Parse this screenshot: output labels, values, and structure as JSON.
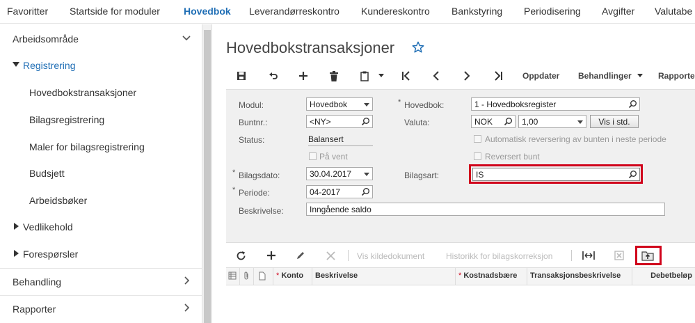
{
  "topnav": {
    "items": [
      "Favoritter",
      "Startside for moduler",
      "Hovedbok",
      "Leverandørreskontro",
      "Kundereskontro",
      "Bankstyring",
      "Periodisering",
      "Avgifter",
      "Valutabe"
    ],
    "active_index": 2
  },
  "sidebar": {
    "arbeidsomrade": "Arbeidsområde",
    "registrering": "Registrering",
    "items": [
      "Hovedbokstransaksjoner",
      "Bilagsregistrering",
      "Maler for bilagsregistrering",
      "Budsjett",
      "Arbeidsbøker"
    ],
    "vedlikehold": "Vedlikehold",
    "foresporsler": "Forespørsler",
    "behandling": "Behandling",
    "rapporter": "Rapporter"
  },
  "page": {
    "title": "Hovedbokstransaksjoner"
  },
  "toolbar": {
    "oppdater": "Oppdater",
    "behandlinger": "Behandlinger",
    "rapporter": "Rapporter"
  },
  "form": {
    "modul_label": "Modul:",
    "modul_value": "Hovedbok",
    "buntnr_label": "Buntnr.:",
    "buntnr_value": "<NY>",
    "status_label": "Status:",
    "status_value": "Balansert",
    "pa_vent_label": "På vent",
    "bilagsdato_label": "Bilagsdato:",
    "bilagsdato_value": "30.04.2017",
    "periode_label": "Periode:",
    "periode_value": "04-2017",
    "beskrivelse_label": "Beskrivelse:",
    "beskrivelse_value": "Inngående saldo",
    "hovedbok_label": "Hovedbok:",
    "hovedbok_value": "1 - Hovedboksregister",
    "valuta_label": "Valuta:",
    "valuta_value": "NOK",
    "valuta_rate": "1,00",
    "vis_i_std": "Vis i std.",
    "auto_reversering_label": "Automatisk reversering av bunten i neste periode",
    "reversert_bunt_label": "Reversert bunt",
    "bilagsart_label": "Bilagsart:",
    "bilagsart_value": "IS"
  },
  "grid_toolbar": {
    "vis_kildedokument": "Vis kildedokument",
    "historikk": "Historikk for bilagskorreksjon"
  },
  "grid": {
    "columns": [
      "Konto",
      "Beskrivelse",
      "Kostnadsbære",
      "Transaksjonsbeskrivelse",
      "Debetbeløp"
    ]
  },
  "colors": {
    "accent": "#1f6eb5",
    "highlight": "#d0021b"
  }
}
